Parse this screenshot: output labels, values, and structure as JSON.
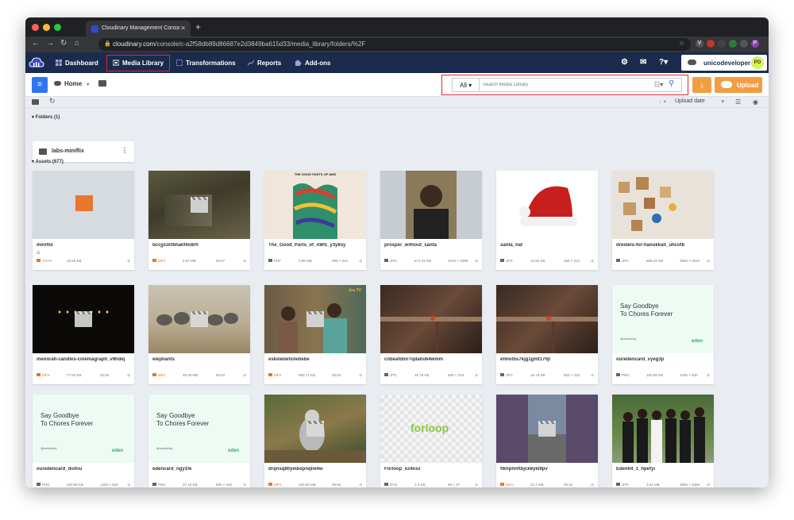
{
  "browser": {
    "tab_title": "Cloudinary Management Conso",
    "url_host": "cloudinary.com",
    "url_path": "/console/c-a2f58db89d86687e2d3849ba615d33/media_library/folders/%2F"
  },
  "nav": {
    "items": [
      "Dashboard",
      "Media Library",
      "Transformations",
      "Reports",
      "Add-ons"
    ],
    "active": "Media Library",
    "user": "unicodeveloper",
    "initials": "PO"
  },
  "toolbar": {
    "home_label": "Home",
    "search_scope": "All",
    "search_placeholder": "Search Media Library",
    "upload_label": "Upload"
  },
  "subbar": {
    "sort_label": "Upload date"
  },
  "folders": {
    "header": "Folders (1)",
    "items": [
      {
        "name": "labs-miniflix"
      }
    ]
  },
  "assets": {
    "header": "Assets (677)",
    "items": [
      {
        "name": "miniflix",
        "type": "JSON",
        "size": "28.55 KB",
        "duration": "",
        "dims": ""
      },
      {
        "name": "bccjjxzkfbhakf4o8rfi",
        "type": "MP4",
        "size": "5.97 MB",
        "duration": "00:07",
        "dims": ""
      },
      {
        "name": "The_Good_Parts_of_AWS_y3y8sy",
        "type": "PDF",
        "size": "3.98 MB",
        "duration": "",
        "dims": "595 × 841"
      },
      {
        "name": "prosper_without_santa",
        "type": "JPG",
        "size": "871.31 KB",
        "duration": "",
        "dims": "2576 × 3088"
      },
      {
        "name": "santa_hat",
        "type": "JPG",
        "size": "10.82 KB",
        "duration": "",
        "dims": "258 × 212"
      },
      {
        "name": "dreidels-for-hanukkah_uhcotb",
        "type": "JPG",
        "size": "868.44 KB",
        "duration": "",
        "dims": "3960 × 2640"
      },
      {
        "name": "menorah-candles-cinemagraph_v9hdej",
        "type": "MP4",
        "size": "77.83 KB",
        "duration": "00:00",
        "dims": ""
      },
      {
        "name": "elephants",
        "type": "MP4",
        "size": "39.46 MB",
        "duration": "00:52",
        "dims": ""
      },
      {
        "name": "eskelebetiolebebe",
        "type": "MP4",
        "size": "883.71 KB",
        "duration": "00:04",
        "dims": ""
      },
      {
        "name": "cnbeafdmr7qdaho64wmm",
        "type": "JPG",
        "size": "16.76 KB",
        "duration": "",
        "dims": "500 × 333"
      },
      {
        "name": "ehhotbs7kjg1gmt170jl",
        "type": "JPG",
        "size": "16.76 KB",
        "duration": "",
        "dims": "500 × 333"
      },
      {
        "name": "ouredencard_vyeg3p",
        "type": "PNG",
        "size": "183.88 KB",
        "duration": "",
        "dims": "1200 × 630"
      },
      {
        "name": "ouredencard_iksfnu",
        "type": "PNG",
        "size": "183.88 KB",
        "duration": "",
        "dims": "1200 × 630"
      },
      {
        "name": "edencard_ngy1fe",
        "type": "PNG",
        "size": "37.16 KB",
        "duration": "",
        "dims": "800 × 420"
      },
      {
        "name": "drqnsq80ymbiipnqhe4w",
        "type": "MP4",
        "size": "150.69 MB",
        "duration": "09:56",
        "dims": ""
      },
      {
        "name": "Forloop_oz4nxz",
        "type": "SVG",
        "size": "2.3 KB",
        "duration": "",
        "dims": "99 × 37"
      },
      {
        "name": "flkhphnftbjck8ykl9pv",
        "type": "MOV",
        "size": "22.7 MB",
        "duration": "00:32",
        "dims": ""
      },
      {
        "name": "Eden04_1_hpefyi",
        "type": "JPG",
        "size": "3.93 MB",
        "duration": "",
        "dims": "4896 × 3265"
      }
    ]
  },
  "thumb_text": {
    "aws_title": "THE GOOD PARTS OF AWS",
    "ad_line1": "Say Goodbye",
    "ad_line2": "To Chores Forever",
    "ad_handle": "@ouredenhq",
    "eden_logo": "eden",
    "forloop_logo": "forloop",
    "tv_label": "Jos TV"
  }
}
